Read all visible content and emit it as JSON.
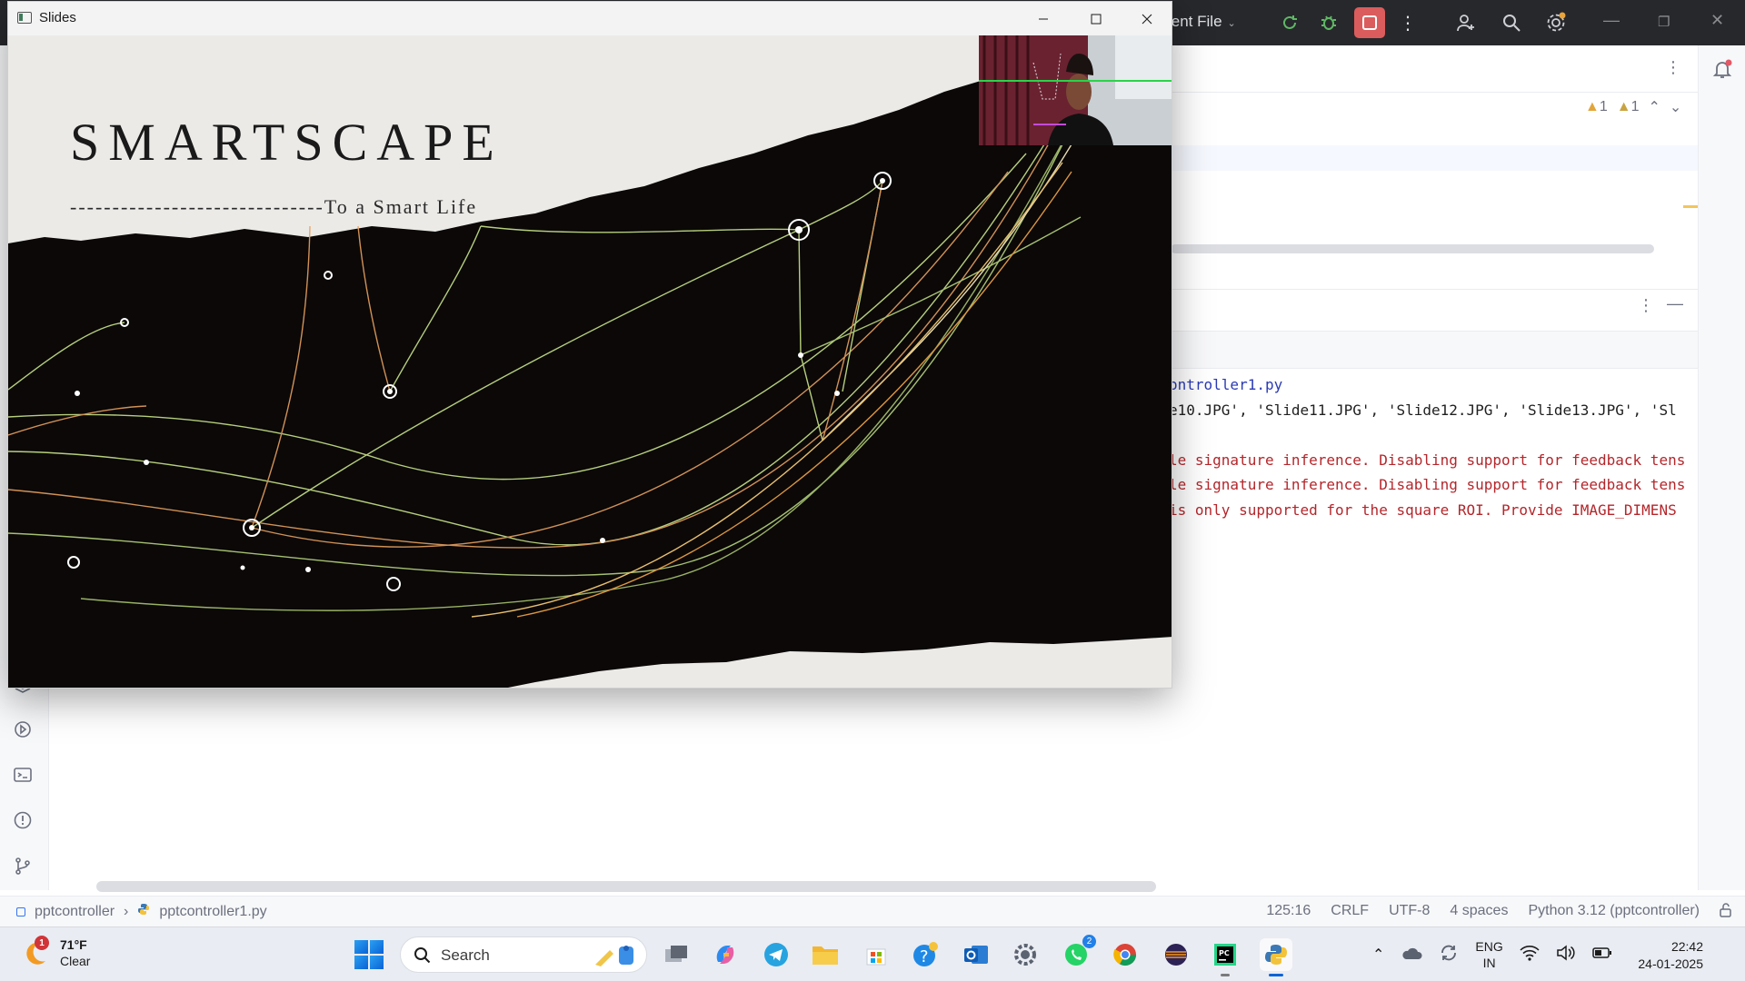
{
  "ide": {
    "run_config": "urrent File",
    "warnings": {
      "first": "1",
      "second": "1"
    },
    "console_lines": [
      {
        "cls": "c-path",
        "text": "ontroller1.py"
      },
      {
        "cls": "c-out",
        "text": "e10.JPG', 'Slide11.JPG', 'Slide12.JPG', 'Slide13.JPG', 'Sl"
      },
      {
        "cls": "c-out",
        "text": ""
      },
      {
        "cls": "c-err",
        "text": "le signature inference. Disabling support for feedback tens"
      },
      {
        "cls": "c-err",
        "text": "le signature inference. Disabling support for feedback tens"
      },
      {
        "cls": "c-err",
        "text": "is only supported for the square ROI. Provide IMAGE_DIMENS"
      }
    ],
    "statusbar": {
      "project": "pptcontroller",
      "file": "pptcontroller1.py",
      "position": "125:16",
      "line_ending": "CRLF",
      "encoding": "UTF-8",
      "indent": "4 spaces",
      "interpreter": "Python 3.12 (pptcontroller)"
    }
  },
  "slides_window": {
    "title": "Slides",
    "slide": {
      "title": "SMARTSCAPE",
      "subtitle": "------------------------------To a Smart Life"
    }
  },
  "taskbar": {
    "weather": {
      "temp": "71°F",
      "condition": "Clear",
      "badge": "1"
    },
    "search_placeholder": "Search",
    "whatsapp_badge": "2",
    "language": {
      "line1": "ENG",
      "line2": "IN"
    },
    "time": "22:42",
    "date": "24-01-2025"
  }
}
